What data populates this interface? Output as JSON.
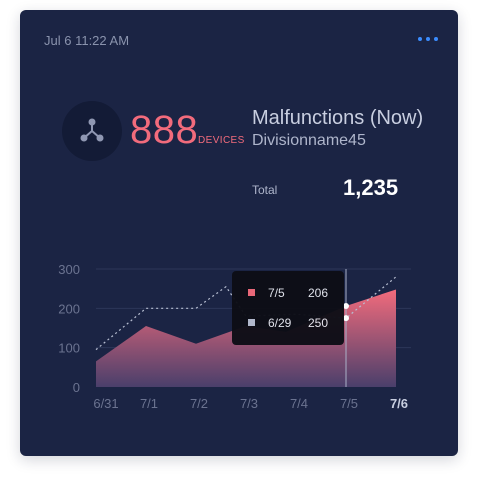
{
  "header": {
    "timestamp": "Jul 6 11:22 AM",
    "menu_icon": "more-horizontal-icon"
  },
  "metric": {
    "icon": "network-icon",
    "value": "888",
    "unit": "DEVICES",
    "title": "Malfunctions (Now)",
    "subtitle": "Divisionname45",
    "total_label": "Total",
    "total_value": "1,235"
  },
  "colors": {
    "accent": "#f26b7c",
    "background": "#1b2444",
    "link": "#3b8cff",
    "series_today": "#f26b7c",
    "series_prev": "#b8bfd2"
  },
  "tooltip": {
    "rows": [
      {
        "date": "7/5",
        "value": "206",
        "color": "#f26b7c"
      },
      {
        "date": "6/29",
        "value": "250",
        "color": "#b8bfd2"
      }
    ]
  },
  "chart_data": {
    "type": "area",
    "categories": [
      "6/31",
      "7/1",
      "7/2",
      "7/3",
      "7/4",
      "7/5",
      "7/6"
    ],
    "ylim": [
      0,
      300
    ],
    "yticks": [
      0,
      100,
      200,
      300
    ],
    "grid": true,
    "highlight_category": "7/6",
    "series": [
      {
        "style": "area",
        "points": [
          {
            "x": 0.0,
            "y": 65
          },
          {
            "x": 1.0,
            "y": 155
          },
          {
            "x": 2.0,
            "y": 110
          },
          {
            "x": 3.0,
            "y": 155
          },
          {
            "x": 3.8,
            "y": 140
          },
          {
            "x": 5.0,
            "y": 206
          },
          {
            "x": 6.0,
            "y": 248
          }
        ]
      },
      {
        "style": "dotted",
        "points": [
          {
            "x": 0.0,
            "y": 95
          },
          {
            "x": 1.0,
            "y": 200
          },
          {
            "x": 2.0,
            "y": 200
          },
          {
            "x": 2.6,
            "y": 255
          },
          {
            "x": 3.0,
            "y": 180
          },
          {
            "x": 4.0,
            "y": 185
          },
          {
            "x": 5.0,
            "y": 175
          },
          {
            "x": 6.0,
            "y": 280
          }
        ]
      }
    ],
    "marker_category": "7/5",
    "marker_values": [
      206,
      175
    ]
  }
}
